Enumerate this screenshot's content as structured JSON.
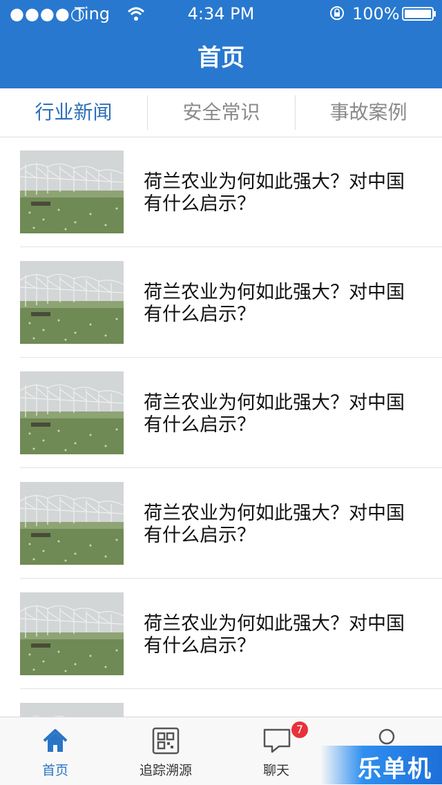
{
  "status_bar": {
    "signal": "●●●●○",
    "carrier": "Ting",
    "time": "4:34 PM",
    "battery": "100%"
  },
  "nav": {
    "title": "首页"
  },
  "tabs": [
    {
      "label": "行业新闻",
      "active": true
    },
    {
      "label": "安全常识",
      "active": false
    },
    {
      "label": "事故案例",
      "active": false
    }
  ],
  "news": [
    {
      "title": "荷兰农业为何如此强大？对中国有什么启示？"
    },
    {
      "title": "荷兰农业为何如此强大？对中国有什么启示？"
    },
    {
      "title": "荷兰农业为何如此强大？对中国有什么启示？"
    },
    {
      "title": "荷兰农业为何如此强大？对中国有什么启示？"
    },
    {
      "title": "荷兰农业为何如此强大？对中国有什么启示？"
    },
    {
      "title": ""
    }
  ],
  "tabbar": {
    "items": [
      {
        "label": "首页",
        "icon": "home-icon",
        "active": true
      },
      {
        "label": "追踪溯源",
        "icon": "qr-code-icon",
        "active": false
      },
      {
        "label": "聊天",
        "icon": "chat-bubble-icon",
        "active": false,
        "badge": "7"
      },
      {
        "label": "",
        "icon": "user-icon",
        "active": false
      }
    ]
  },
  "watermark": "乐单机",
  "colors": {
    "brand": "#2878cf",
    "active_tab": "#2c6fb9",
    "badge": "#e8313b"
  }
}
